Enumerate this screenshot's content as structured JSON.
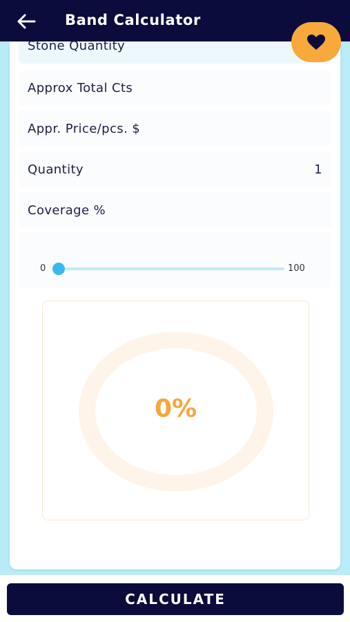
{
  "header": {
    "title": "Band Calculator",
    "back_icon": "arrow-left-icon"
  },
  "fav": {
    "icon": "heart-icon"
  },
  "fields": [
    {
      "label": "Stone Quantity",
      "value": ""
    },
    {
      "label": "Approx Total Cts",
      "value": ""
    },
    {
      "label": "Appr. Price/pcs. $",
      "value": ""
    },
    {
      "label": "Quantity",
      "value": "1"
    },
    {
      "label": "Coverage %",
      "value": ""
    }
  ],
  "slider": {
    "min": "0",
    "max": "100",
    "value": 0
  },
  "gauge": {
    "percent_text": "0%",
    "value": 0
  },
  "calculate_label": "CALCULATE",
  "colors": {
    "header": "#0b0c3b",
    "accent": "#f7a93c",
    "slider": "#3cb8ee"
  }
}
